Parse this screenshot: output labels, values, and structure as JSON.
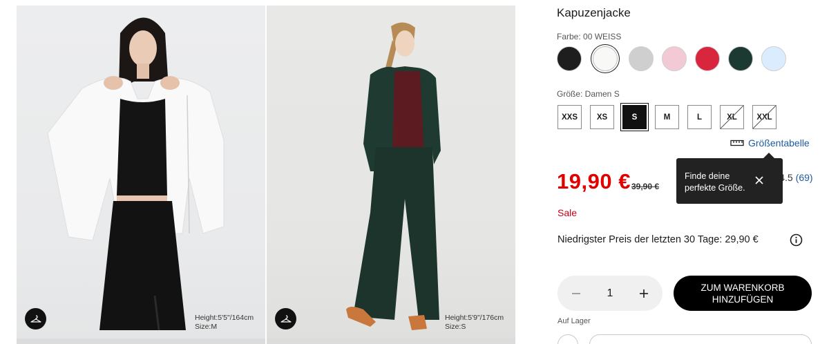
{
  "product": {
    "title": "Kapuzenjacke",
    "color_label": "Farbe: 00 WEISS",
    "colors": [
      {
        "name": "black",
        "hex": "#1e1e1e"
      },
      {
        "name": "white",
        "hex": "#f8f8f6",
        "selected": true
      },
      {
        "name": "gray",
        "hex": "#cfcfcf"
      },
      {
        "name": "pink",
        "hex": "#f4c9d6"
      },
      {
        "name": "red",
        "hex": "#d7263d"
      },
      {
        "name": "dark-green",
        "hex": "#1d3a32"
      },
      {
        "name": "light-blue",
        "hex": "#dcecff"
      }
    ],
    "size_label": "Größe: Damen S",
    "sizes": [
      {
        "label": "XXS",
        "state": "available"
      },
      {
        "label": "XS",
        "state": "available"
      },
      {
        "label": "S",
        "state": "selected"
      },
      {
        "label": "M",
        "state": "available"
      },
      {
        "label": "L",
        "state": "available"
      },
      {
        "label": "XL",
        "state": "unavailable"
      },
      {
        "label": "XXL",
        "state": "unavailable"
      }
    ],
    "size_chart_label": "Größentabelle",
    "price": "19,90 €",
    "old_price": "39,90 €",
    "rating_value": "4.5",
    "rating_count": "(69)",
    "sale_label": "Sale",
    "lowest_price": "Niedrigster Preis der letzten 30 Tage: 29,90 €",
    "quantity": "1",
    "add_to_cart": "ZUM WARENKORB HINZUFÜGEN",
    "stock": "Auf Lager"
  },
  "tooltip": {
    "text": "Finde deine perfekte Größe."
  },
  "gallery": [
    {
      "model_height": "Height:5'5\"/164cm",
      "model_size": "Size:M"
    },
    {
      "model_height": "Height:5'9\"/176cm",
      "model_size": "Size:S"
    }
  ],
  "colors": {
    "price_red": "#e00000",
    "sale_red": "#c4001a",
    "link_blue": "#1e5aa0",
    "tooltip_bg": "#222222"
  },
  "icons": {
    "hanger": "hanger-icon",
    "ruler": "ruler-icon",
    "info": "info-icon",
    "close": "close-icon",
    "minus": "minus-icon",
    "plus": "plus-icon"
  }
}
